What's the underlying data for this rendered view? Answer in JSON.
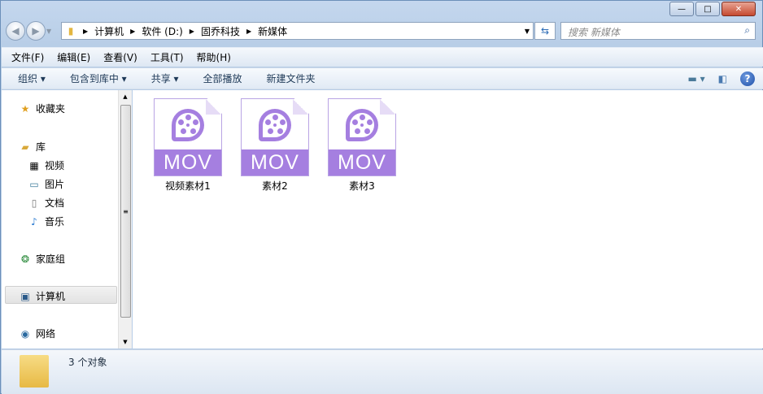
{
  "window": {
    "min": "—",
    "max": "□",
    "close": "✕"
  },
  "address": {
    "segments": [
      "计算机",
      "软件 (D:)",
      "固乔科技",
      "新媒体"
    ]
  },
  "search": {
    "placeholder": "搜索 新媒体"
  },
  "menu": [
    "文件(F)",
    "编辑(E)",
    "查看(V)",
    "工具(T)",
    "帮助(H)"
  ],
  "toolbar": {
    "organize": "组织 ▾",
    "include": "包含到库中 ▾",
    "share": "共享 ▾",
    "play_all": "全部播放",
    "new_folder": "新建文件夹",
    "help": "?"
  },
  "sidebar": {
    "favorites": "收藏夹",
    "libraries": "库",
    "video": "视频",
    "pictures": "图片",
    "documents": "文档",
    "music": "音乐",
    "homegroup": "家庭组",
    "computer": "计算机",
    "network": "网络"
  },
  "files": [
    {
      "name": "视频素材1",
      "ext": "MOV"
    },
    {
      "name": "素材2",
      "ext": "MOV"
    },
    {
      "name": "素材3",
      "ext": "MOV"
    }
  ],
  "status": {
    "count": "3 个对象"
  },
  "colors": {
    "accent": "#a57fe0"
  }
}
